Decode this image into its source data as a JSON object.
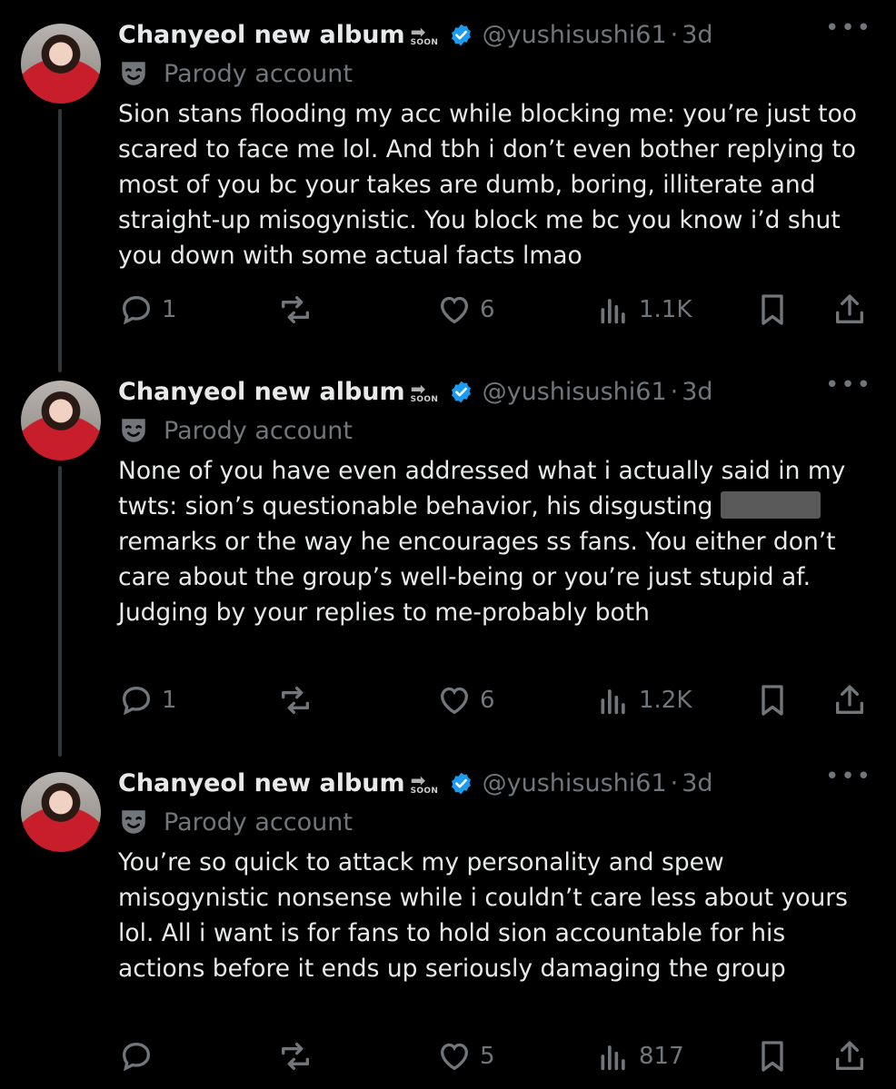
{
  "tweets": [
    {
      "display_name": "Chanyeol new album",
      "badge_label": "SOON",
      "handle": "@yushisushi61",
      "separator": "·",
      "time": "3d",
      "parody_label": "Parody account",
      "text": "Sion stans flooding my acc while blocking me: you’re just too scared to face me lol. And tbh i don’t even bother replying to most of you bc your takes are dumb, boring, illiterate and straight-up misogynistic. You block me bc you know i’d shut you down with some actual facts lmao",
      "replies": "1",
      "reposts": "",
      "likes": "6",
      "views": "1.1K"
    },
    {
      "display_name": "Chanyeol new album",
      "badge_label": "SOON",
      "handle": "@yushisushi61",
      "separator": "·",
      "time": "3d",
      "parody_label": "Parody account",
      "text_before": "None of you have even addressed what i actually said in my twts: sion’s questionable behavior, his disgusting ",
      "text_after": "remarks or the way he encourages ss fans. You either don’t care about the group’s well-being or you’re just stupid af. Judging by your replies to me-probably both",
      "replies": "1",
      "reposts": "",
      "likes": "6",
      "views": "1.2K"
    },
    {
      "display_name": "Chanyeol new album",
      "badge_label": "SOON",
      "handle": "@yushisushi61",
      "separator": "·",
      "time": "3d",
      "parody_label": "Parody account",
      "text": "You’re so quick to attack my personality and spew misogynistic nonsense while i couldn’t care less about yours lol. All i want is for fans to hold sion accountable for his actions before it ends up seriously damaging the group",
      "replies": "",
      "reposts": "",
      "likes": "5",
      "views": "817"
    }
  ],
  "icons": {
    "verified": "verified-badge-icon",
    "parody": "theater-mask-icon",
    "more": "more-options-icon",
    "reply": "reply-icon",
    "repost": "repost-icon",
    "like": "like-icon",
    "views": "views-icon",
    "bookmark": "bookmark-icon",
    "share": "share-icon"
  },
  "colors": {
    "background": "#000000",
    "text": "#e7e9ea",
    "muted": "#71767b",
    "verified": "#1d9bf0"
  }
}
